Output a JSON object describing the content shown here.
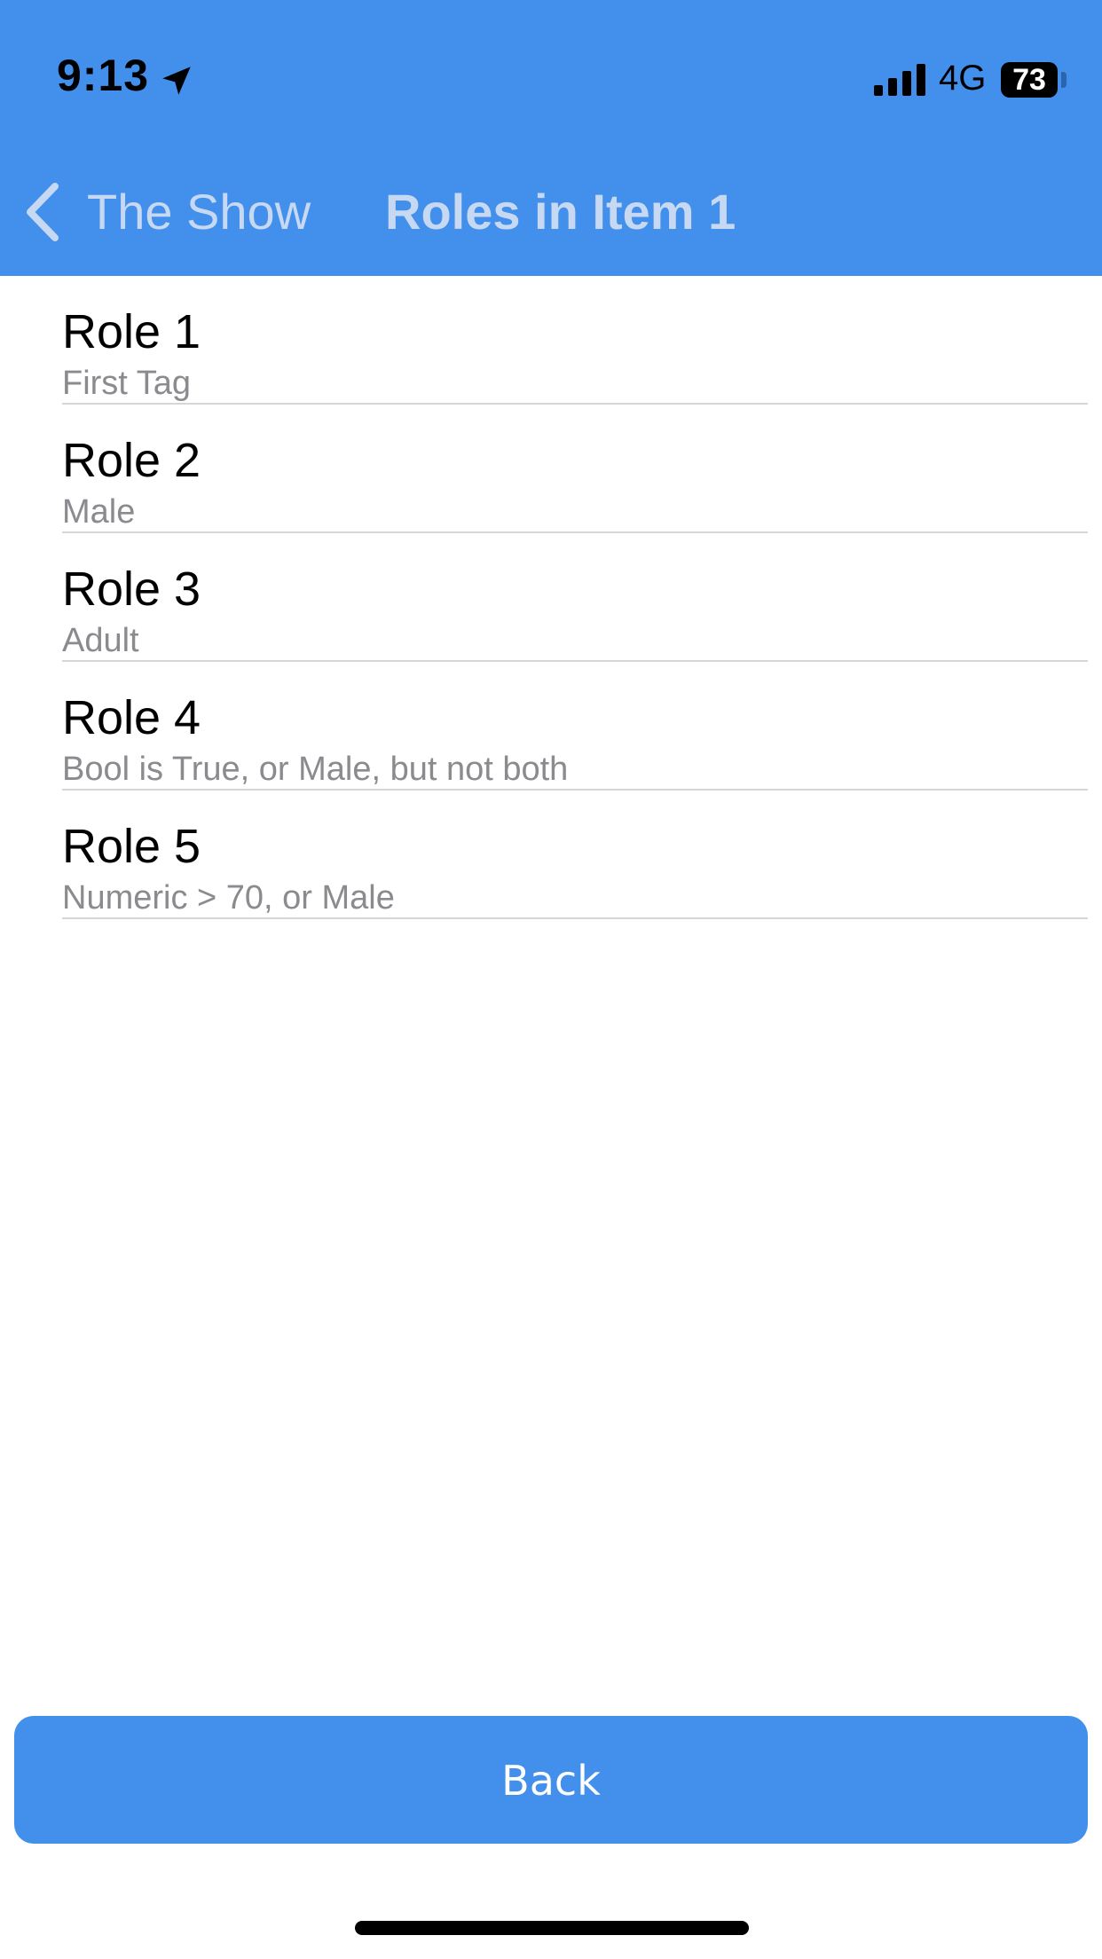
{
  "status_bar": {
    "time": "9:13",
    "network": "4G",
    "battery": "73",
    "icons": [
      "location-arrow-icon",
      "signal-bars-icon",
      "battery-icon"
    ]
  },
  "nav": {
    "back_label": "The Show",
    "title": "Roles in Item 1",
    "back_icon": "chevron-left-icon"
  },
  "roles": [
    {
      "title": "Role 1",
      "subtitle": "First Tag"
    },
    {
      "title": "Role 2",
      "subtitle": "Male"
    },
    {
      "title": "Role 3",
      "subtitle": "Adult"
    },
    {
      "title": "Role 4",
      "subtitle": "Bool is True, or Male, but not both"
    },
    {
      "title": "Role 5",
      "subtitle": "Numeric > 70, or Male"
    }
  ],
  "footer": {
    "back_button_label": "Back"
  },
  "colors": {
    "accent": "#428fec",
    "nav_text": "#c7d9f2",
    "subtitle": "#8a8a8f",
    "separator": "#d6d6d6"
  }
}
